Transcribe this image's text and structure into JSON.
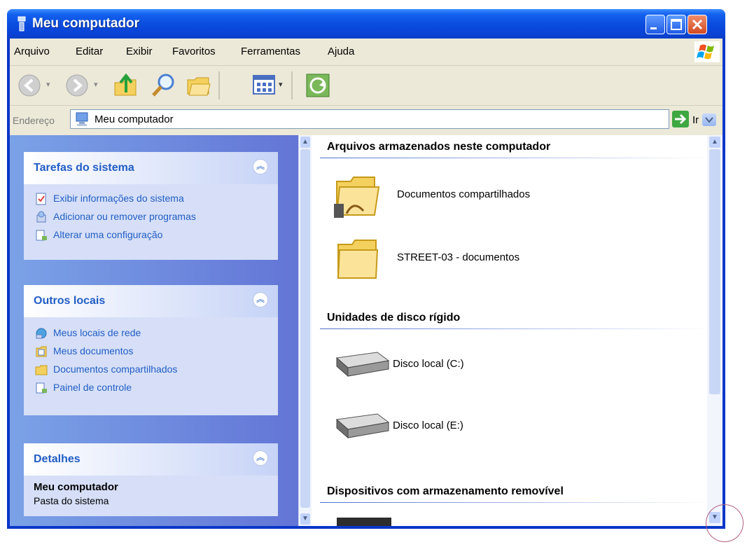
{
  "window": {
    "title": "Meu computador"
  },
  "menubar": {
    "items": [
      "Arquivo",
      "Editar",
      "Exibir",
      "Favoritos",
      "Ferramentas",
      "Ajuda"
    ]
  },
  "toolbar": {
    "icons": [
      "back-icon",
      "forward-icon",
      "up-folder-icon",
      "search-icon",
      "folders-icon",
      "views-icon",
      "sync-icon"
    ]
  },
  "address": {
    "label": "Endereço",
    "value": "Meu computador",
    "go_label": "Ir"
  },
  "sidebar": {
    "system_tasks": {
      "title": "Tarefas do sistema",
      "items": [
        "Exibir informações do sistema",
        "Adicionar ou remover programas",
        "Alterar uma configuração"
      ]
    },
    "other_places": {
      "title": "Outros locais",
      "items": [
        "Meus locais de rede",
        "Meus documentos",
        "Documentos compartilhados",
        "Painel de controle"
      ]
    },
    "details": {
      "title": "Detalhes",
      "name": "Meu computador",
      "subtitle": "Pasta do sistema"
    }
  },
  "content": {
    "groups": [
      {
        "header": "Arquivos armazenados neste computador",
        "items": [
          "Documentos compartilhados",
          "STREET-03 - documentos"
        ]
      },
      {
        "header": "Unidades de disco rígido",
        "items": [
          "Disco local (C:)",
          "Disco local (E:)"
        ]
      },
      {
        "header": "Dispositivos com armazenamento removível",
        "items": []
      }
    ]
  },
  "colors": {
    "title_bar": "#0b4de0",
    "sidebar_link": "#215dc6",
    "close_button": "#d34a22"
  }
}
